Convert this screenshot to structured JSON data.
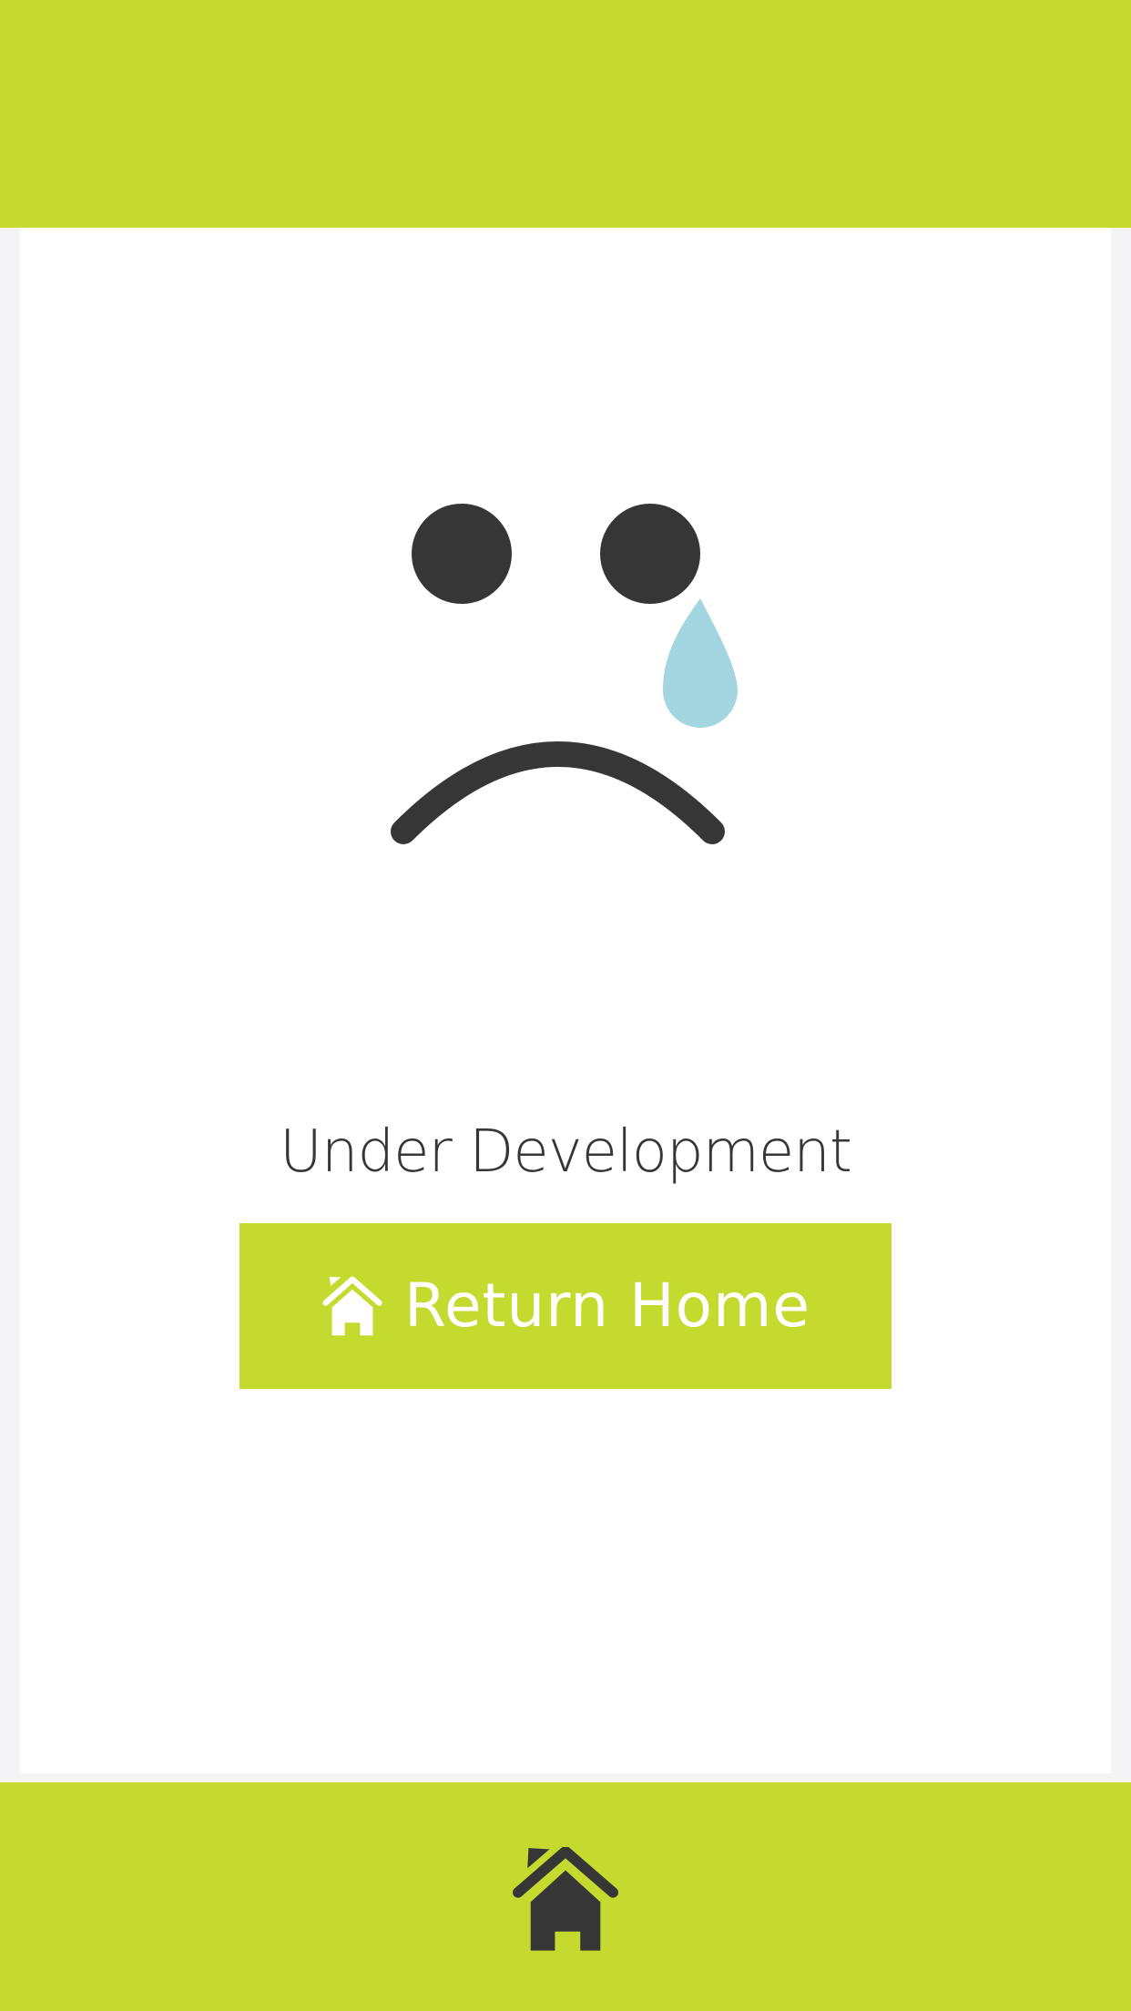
{
  "app": {
    "accent_color": "#c5da2f",
    "text_color": "#363636",
    "tear_color": "#a3d6e0"
  },
  "illustration": {
    "icon": "sad-face-icon"
  },
  "status": {
    "title": "Under Development"
  },
  "return_button": {
    "icon": "home-icon",
    "label": "Return Home"
  },
  "bottom_nav": {
    "icon": "home-icon"
  }
}
